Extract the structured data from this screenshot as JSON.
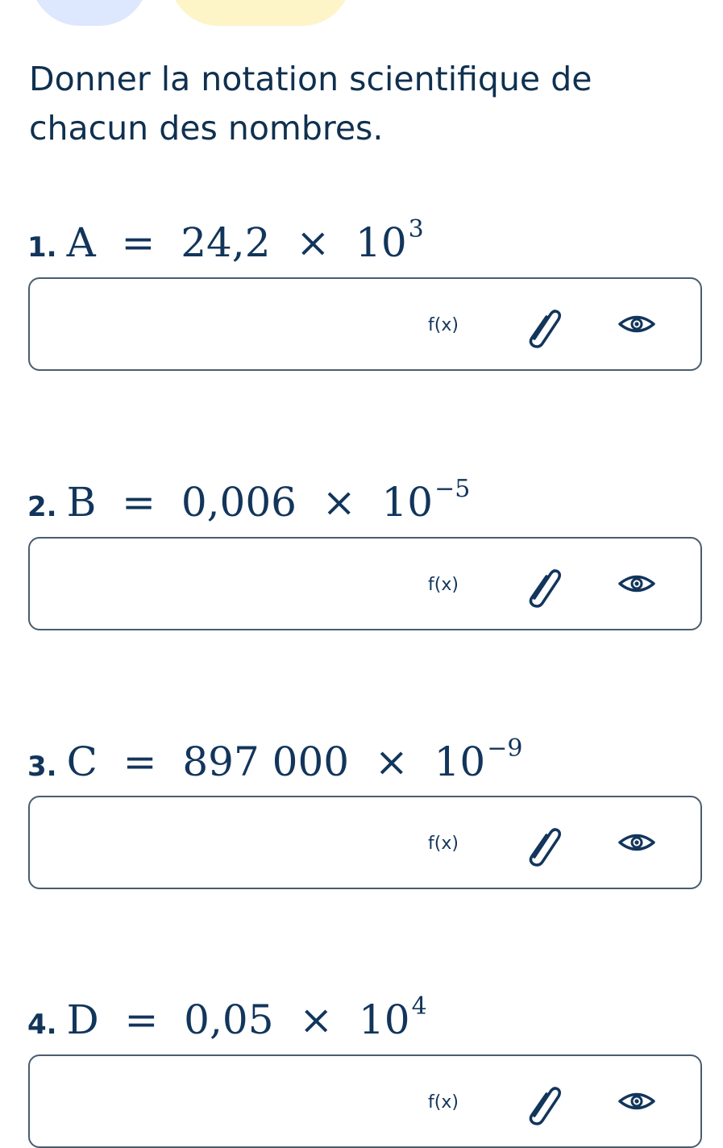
{
  "instruction": "Donner la notation scientifique de chacun des nombres.",
  "questions": [
    {
      "number": "1.",
      "var": "A",
      "mantissa": "24,2",
      "base": "10",
      "exponent": "3"
    },
    {
      "number": "2.",
      "var": "B",
      "mantissa": "0,006",
      "base": "10",
      "exponent": "−5"
    },
    {
      "number": "3.",
      "var": "C",
      "mantissa": "897 000",
      "base": "10",
      "exponent": "−9"
    },
    {
      "number": "4.",
      "var": "D",
      "mantissa": "0,05",
      "base": "10",
      "exponent": "4"
    }
  ],
  "toolbar": {
    "formula_label": "f(x)",
    "formula_icon": "function-icon",
    "attach_icon": "paperclip-icon",
    "preview_icon": "eye-icon"
  },
  "colors": {
    "text": "#12355b",
    "border": "#4a5c6e",
    "pill_blue": "#dde7fd",
    "pill_yellow": "#fdf4c8"
  }
}
